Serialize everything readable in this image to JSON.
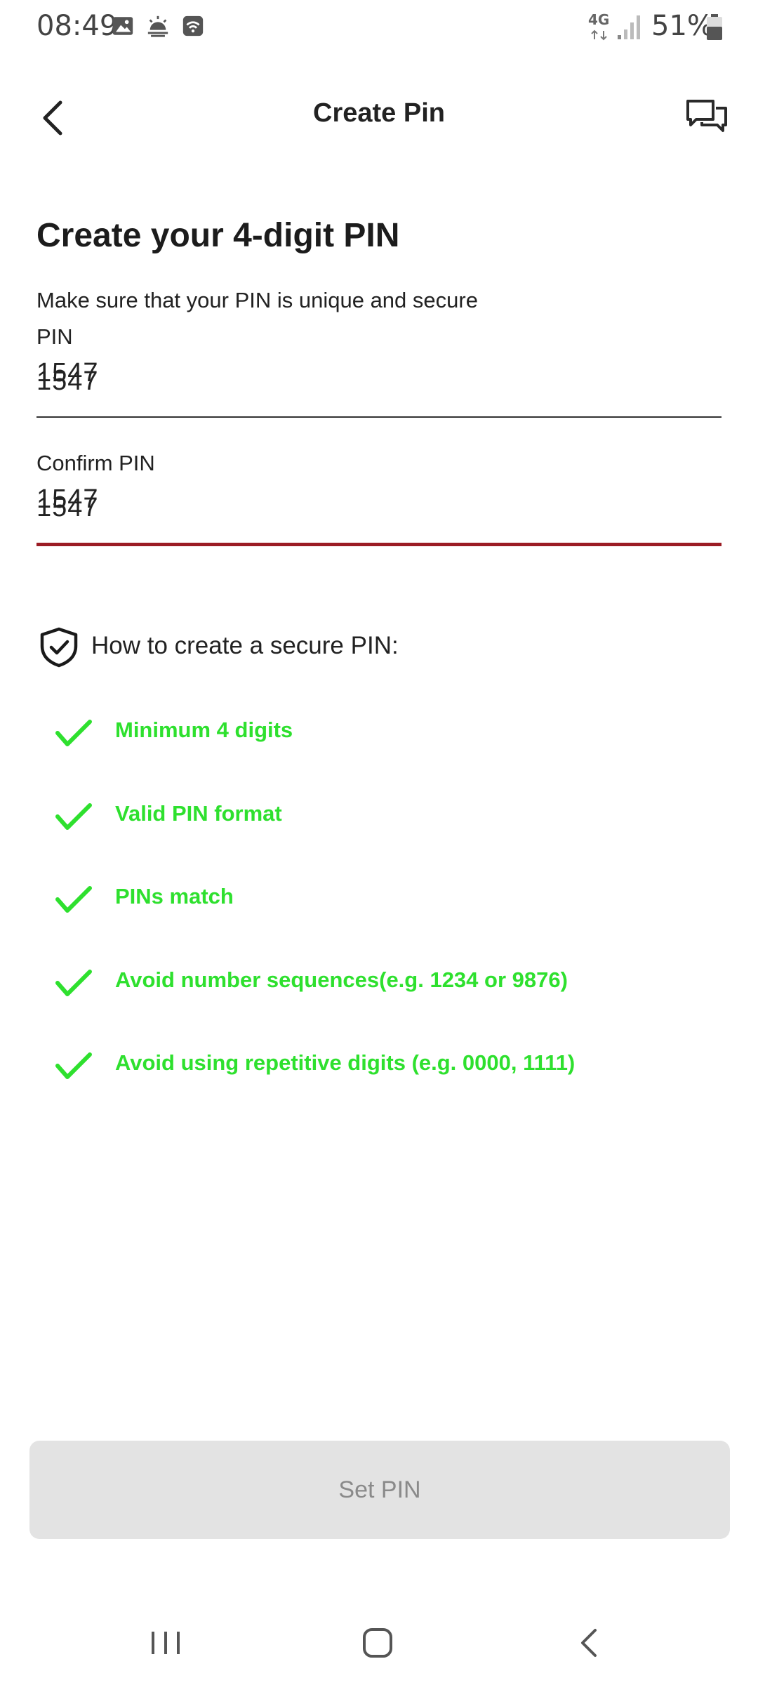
{
  "status_bar": {
    "time": "08:49",
    "network": "4G",
    "battery": "51%"
  },
  "header": {
    "title": "Create Pin"
  },
  "main": {
    "heading": "Create your 4-digit PIN",
    "subtitle": "Make sure that your PIN is unique and secure",
    "pin_label": "PIN",
    "pin_value": "1547",
    "confirm_label": "Confirm PIN",
    "confirm_value": "1547"
  },
  "tips": {
    "title": "How to create a secure PIN:",
    "items": [
      "Minimum 4 digits",
      "Valid PIN format",
      "PINs match",
      "Avoid number sequences(e.g. 1234 or 9876)",
      "Avoid using repetitive digits (e.g. 0000, 1111)"
    ]
  },
  "button": {
    "label": "Set PIN"
  },
  "colors": {
    "accent_red": "#9b1c24",
    "success_green": "#2ee02e",
    "disabled_bg": "#e3e3e3",
    "disabled_text": "#8a8a8a"
  }
}
